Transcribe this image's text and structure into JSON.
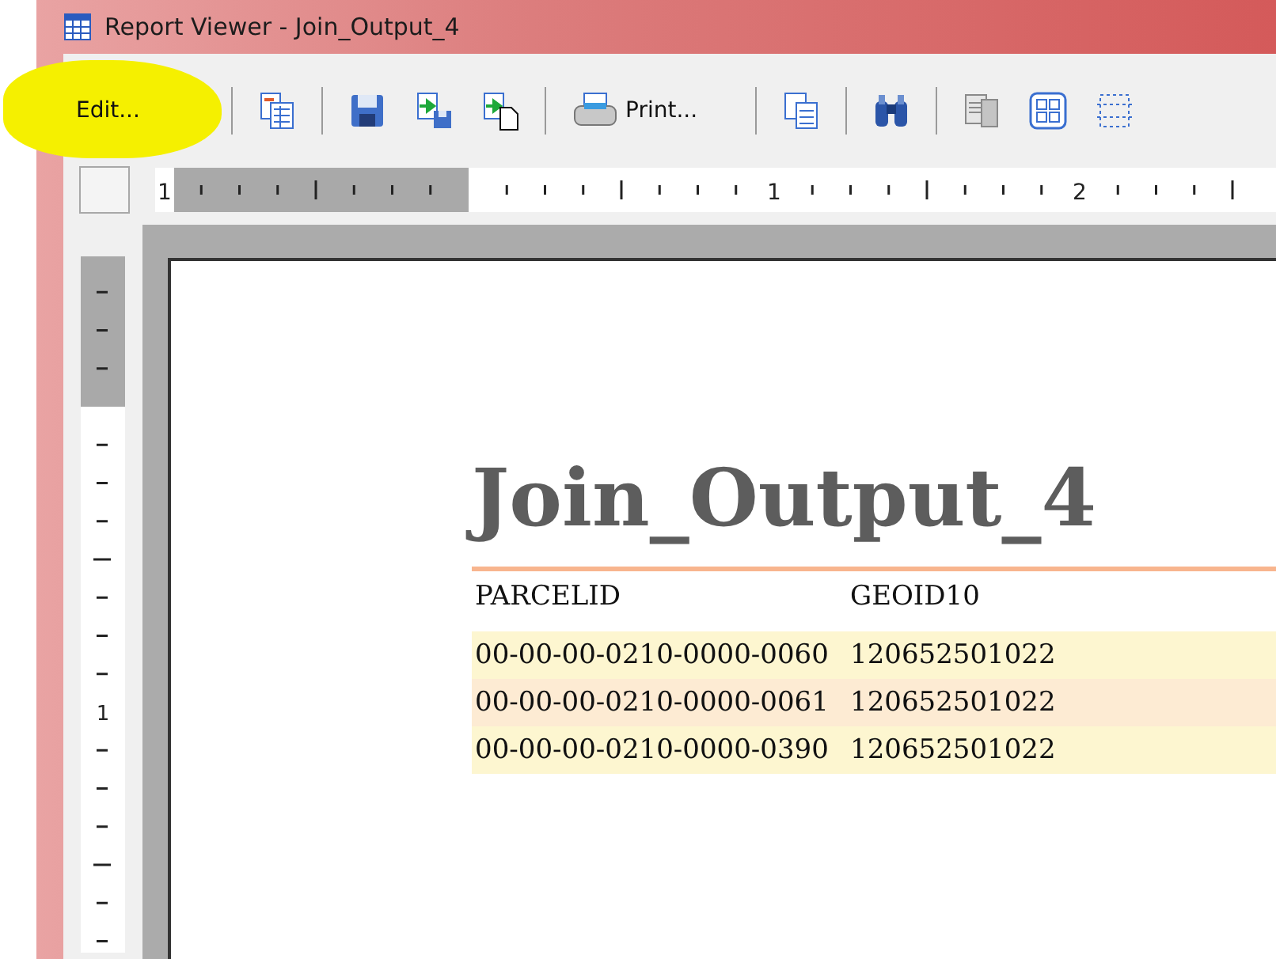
{
  "window": {
    "title": "Report Viewer - Join_Output_4"
  },
  "toolbar": {
    "edit_button": "Edit...",
    "print_button": "Print..."
  },
  "horizontal_ruler": {
    "labels": [
      "1",
      "1",
      "2"
    ]
  },
  "vertical_ruler": {
    "labels": [
      "1"
    ]
  },
  "report": {
    "title": "Join_Output_4",
    "table": {
      "columns": [
        "PARCELID",
        "GEOID10"
      ],
      "rows": [
        {
          "cells": [
            "00-00-00-0210-0000-0060",
            "120652501022"
          ]
        },
        {
          "cells": [
            "00-00-00-0210-0000-0061",
            "120652501022"
          ]
        },
        {
          "cells": [
            "00-00-00-0210-0000-0390",
            "120652501022"
          ]
        }
      ]
    }
  }
}
